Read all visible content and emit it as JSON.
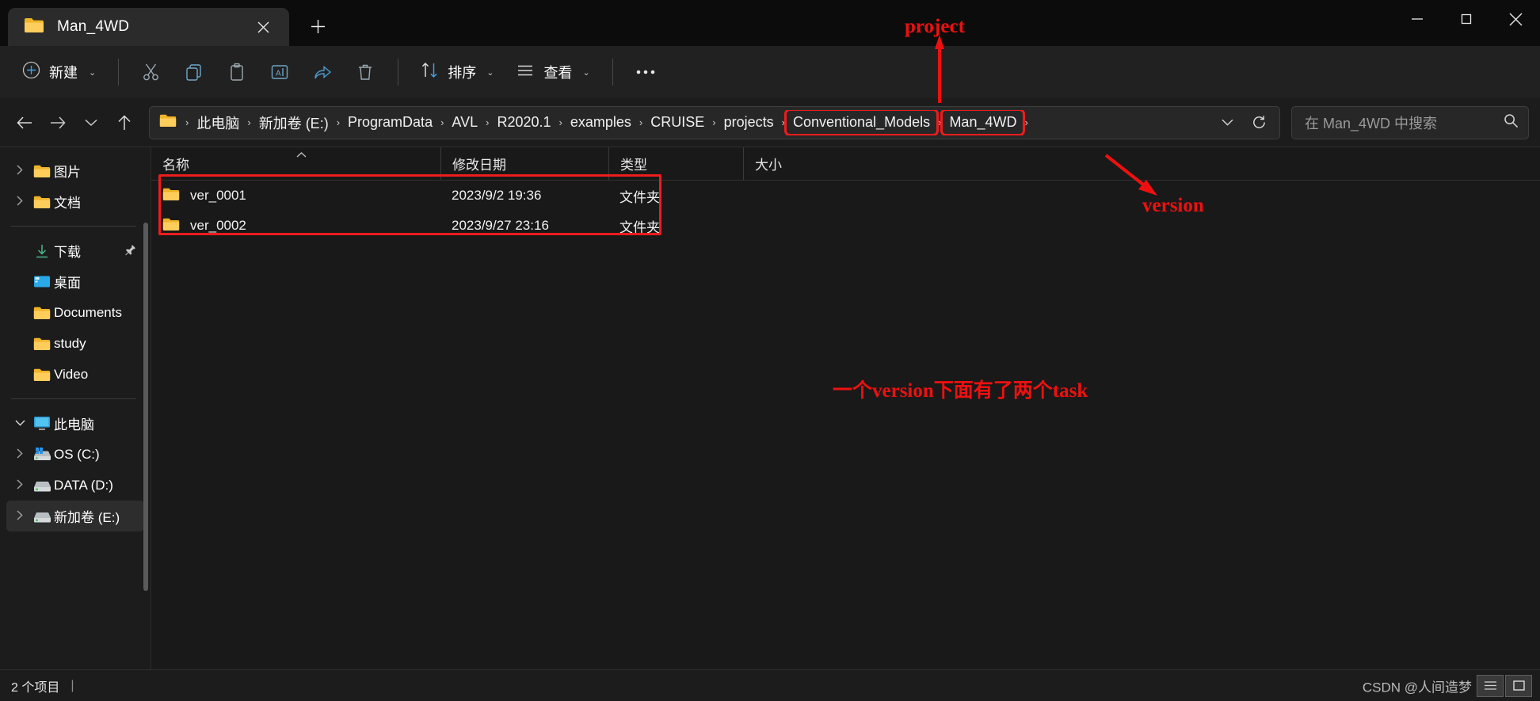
{
  "window": {
    "tab_title": "Man_4WD",
    "close_tab_icon": "✕",
    "new_tab_icon": "✛",
    "minimize_icon": "minimize",
    "maximize_icon": "maximize",
    "close_icon": "close"
  },
  "toolbar": {
    "new_label": "新建",
    "sort_label": "排序",
    "view_label": "查看",
    "chevron": "⌄",
    "more_label": "•••",
    "icons": [
      "cut-icon",
      "copy-icon",
      "paste-icon",
      "rename-icon",
      "share-icon",
      "delete-icon"
    ]
  },
  "nav": {
    "back_icon": "←",
    "forward_icon": "→",
    "recent_icon": "⌄",
    "up_icon": "↑",
    "dropdown_icon": "⌄",
    "refresh_icon": "⟳"
  },
  "breadcrumb": {
    "separator": "›",
    "items": [
      {
        "label": "此电脑",
        "highlighted": false
      },
      {
        "label": "新加卷 (E:)",
        "highlighted": false
      },
      {
        "label": "ProgramData",
        "highlighted": false
      },
      {
        "label": "AVL",
        "highlighted": false
      },
      {
        "label": "R2020.1",
        "highlighted": false
      },
      {
        "label": "examples",
        "highlighted": false
      },
      {
        "label": "CRUISE",
        "highlighted": false
      },
      {
        "label": "projects",
        "highlighted": false
      },
      {
        "label": "Conventional_Models",
        "highlighted": true
      },
      {
        "label": "Man_4WD",
        "highlighted": true
      }
    ]
  },
  "search": {
    "placeholder": "在 Man_4WD 中搜索",
    "icon": "search-icon"
  },
  "sidebar": {
    "items": [
      {
        "label": "图片",
        "icon": "folder-icon",
        "twisty": "collapsed",
        "selected": false,
        "pinned": false
      },
      {
        "label": "文档",
        "icon": "folder-icon",
        "twisty": "collapsed",
        "selected": false,
        "pinned": false
      },
      {
        "divider": true
      },
      {
        "label": "下载",
        "icon": "download-icon",
        "twisty": "none",
        "selected": false,
        "pinned": true
      },
      {
        "label": "桌面",
        "icon": "desktop-icon",
        "twisty": "none",
        "selected": false,
        "pinned": false
      },
      {
        "label": "Documents",
        "icon": "folder-icon",
        "twisty": "none",
        "selected": false,
        "pinned": false
      },
      {
        "label": "study",
        "icon": "folder-icon",
        "twisty": "none",
        "selected": false,
        "pinned": false
      },
      {
        "label": "Video",
        "icon": "folder-icon",
        "twisty": "none",
        "selected": false,
        "pinned": false
      },
      {
        "divider": true
      },
      {
        "label": "此电脑",
        "icon": "monitor-icon",
        "twisty": "expanded",
        "selected": false,
        "pinned": false
      },
      {
        "label": "OS (C:)",
        "icon": "windows-drive-icon",
        "twisty": "collapsed",
        "selected": false,
        "pinned": false
      },
      {
        "label": "DATA (D:)",
        "icon": "drive-icon",
        "twisty": "collapsed",
        "selected": false,
        "pinned": false
      },
      {
        "label": "新加卷 (E:)",
        "icon": "drive-icon",
        "twisty": "collapsed",
        "selected": true,
        "pinned": false
      }
    ]
  },
  "filelist": {
    "columns": [
      {
        "label": "名称",
        "sorted": "asc",
        "sort_icon": "⌃"
      },
      {
        "label": "修改日期",
        "sorted": "",
        "sort_icon": ""
      },
      {
        "label": "类型",
        "sorted": "",
        "sort_icon": ""
      },
      {
        "label": "大小",
        "sorted": "",
        "sort_icon": ""
      }
    ],
    "rows": [
      {
        "name": "ver_0001",
        "modified": "2023/9/2 19:36",
        "type": "文件夹",
        "size": "",
        "icon": "folder-icon"
      },
      {
        "name": "ver_0002",
        "modified": "2023/9/27 23:16",
        "type": "文件夹",
        "size": "",
        "icon": "folder-icon"
      }
    ]
  },
  "statusbar": {
    "item_count": "2 个项目",
    "separator": "|",
    "watermark": "CSDN @人间造梦",
    "view_icons": [
      "details-view-icon",
      "large-icons-view-icon"
    ]
  },
  "annotations": [
    {
      "text": "project",
      "id": "annotation-project"
    },
    {
      "text": "version",
      "id": "annotation-version"
    },
    {
      "text": "一个version下面有了两个task",
      "id": "annotation-task-note"
    }
  ],
  "colors": {
    "accent_red": "#ee1c1c",
    "folder_yellow": "#f5c33f",
    "window_bg": "#1c1c1c"
  }
}
